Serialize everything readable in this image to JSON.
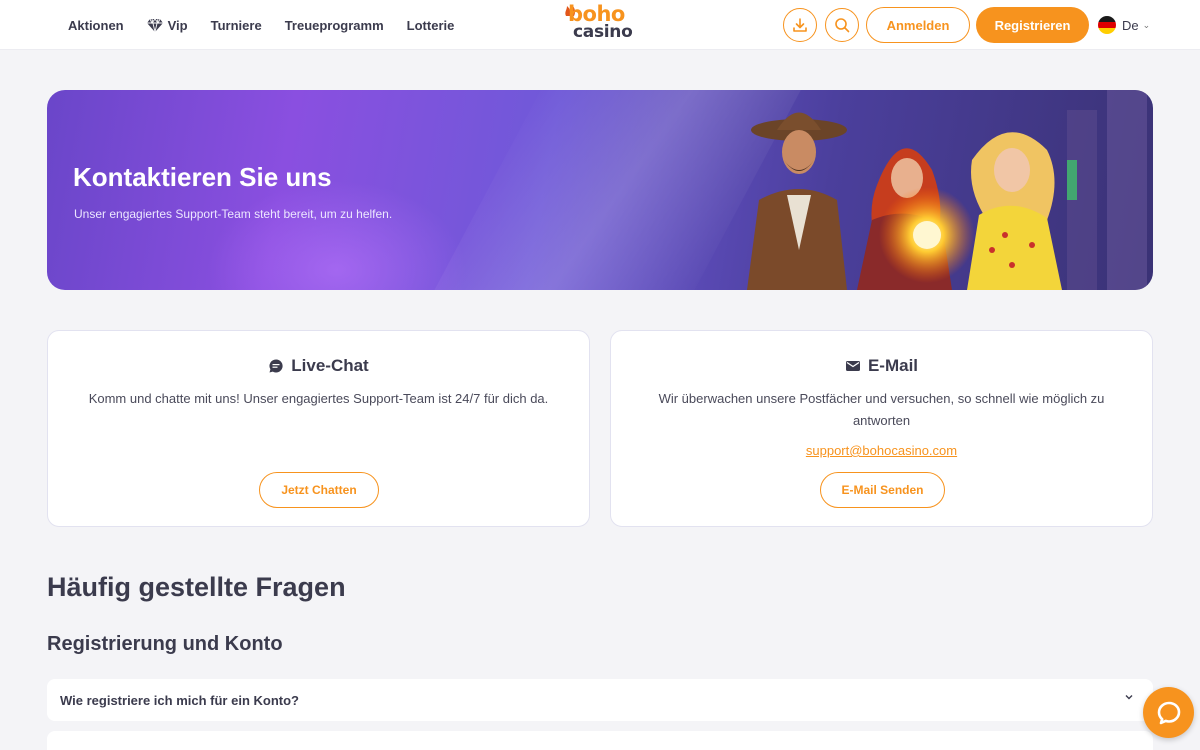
{
  "nav": {
    "items": [
      {
        "label": "Aktionen",
        "icon": ""
      },
      {
        "label": "Vip",
        "icon": "diamond-icon"
      },
      {
        "label": "Turniere",
        "icon": ""
      },
      {
        "label": "Treueprogramm",
        "icon": ""
      },
      {
        "label": "Lotterie",
        "icon": ""
      }
    ]
  },
  "logo": {
    "line1": "boho",
    "line2": "casino"
  },
  "header": {
    "download_icon": "download-icon",
    "search_icon": "search-icon",
    "login_label": "Anmelden",
    "register_label": "Registrieren",
    "language": "De"
  },
  "banner": {
    "title": "Kontaktieren Sie uns",
    "subtitle": "Unser engagiertes Support-Team steht bereit, um zu helfen."
  },
  "cards": {
    "chat": {
      "title": "Live-Chat",
      "text": "Komm und chatte mit uns! Unser engagiertes Support-Team ist 24/7 für dich da.",
      "button": "Jetzt Chatten"
    },
    "email": {
      "title": "E-Mail",
      "text": "Wir überwachen unsere Postfächer und versuchen, so schnell wie möglich zu antworten",
      "link": "support@bohocasino.com",
      "button": "E-Mail Senden"
    }
  },
  "faq": {
    "title": "Häufig gestellte Fragen",
    "section": "Registrierung und Konto",
    "questions": [
      "Wie registriere ich mich für ein Konto?"
    ]
  },
  "colors": {
    "accent": "#f7931e",
    "text": "#3b3b4d",
    "background": "#f4f4f7"
  }
}
